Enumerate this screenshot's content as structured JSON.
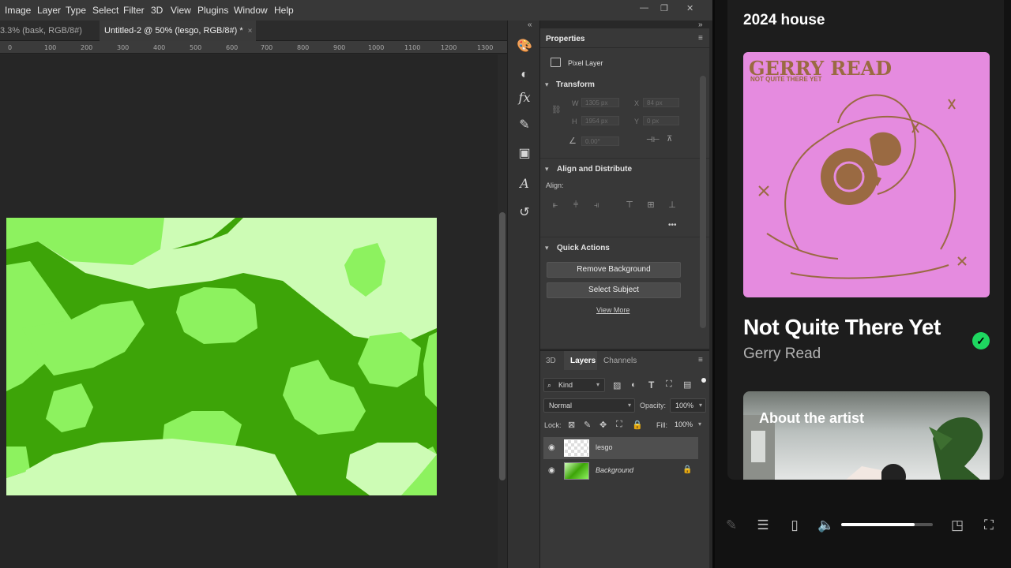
{
  "menu": [
    "Image",
    "Layer",
    "Type",
    "Select",
    "Filter",
    "3D",
    "View",
    "Plugins",
    "Window",
    "Help"
  ],
  "window_controls": {
    "minimize": "—",
    "restore": "❐",
    "close": "✕"
  },
  "doc_tabs": [
    {
      "label": "3.3% (bask, RGB/8#) *",
      "close": "×"
    },
    {
      "label": "Untitled-2 @ 50% (lesgo, RGB/8#) *",
      "close": "×"
    }
  ],
  "ruler_ticks": [
    "0",
    "100",
    "200",
    "300",
    "400",
    "500",
    "600",
    "700",
    "800",
    "900",
    "1000",
    "1100",
    "1200",
    "1300"
  ],
  "properties": {
    "tab": "Properties",
    "layer_type": "Pixel Layer",
    "transform": {
      "title": "Transform",
      "w_label": "W",
      "w": "1305 px",
      "x_label": "X",
      "x": "84 px",
      "h_label": "H",
      "h": "1954 px",
      "y_label": "Y",
      "y": "0 px",
      "angle": "0.00°"
    },
    "align": {
      "title": "Align and Distribute",
      "label": "Align:",
      "more": "•••"
    },
    "quick_actions": {
      "title": "Quick Actions",
      "remove_bg": "Remove Background",
      "select_subject": "Select Subject",
      "view_more": "View More"
    }
  },
  "layers_panel": {
    "tabs": [
      "3D",
      "Layers",
      "Channels"
    ],
    "filter_kind": "Kind",
    "blend_mode": "Normal",
    "opacity_label": "Opacity:",
    "opacity": "100%",
    "lock_label": "Lock:",
    "fill_label": "Fill:",
    "fill": "100%",
    "layers": [
      {
        "name": "lesgo",
        "visible": true,
        "selected": true
      },
      {
        "name": "Background",
        "visible": true,
        "selected": false,
        "locked": true
      }
    ]
  },
  "music": {
    "playlist": "2024 house",
    "cover_artist_text": "GERRY READ",
    "cover_subtitle": "NOT QUITE THERE YET",
    "track_title": "Not Quite There Yet",
    "artist": "Gerry Read",
    "saved_mark": "✓",
    "about_title": "About the artist",
    "volume_fraction": 0.8,
    "accent": "#1ed760"
  }
}
